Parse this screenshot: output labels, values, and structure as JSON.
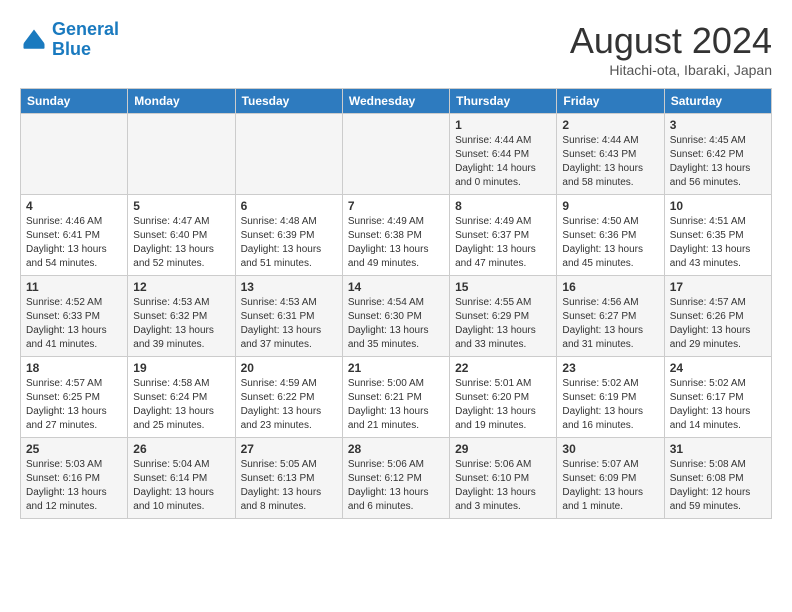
{
  "header": {
    "logo_line1": "General",
    "logo_line2": "Blue",
    "month_year": "August 2024",
    "location": "Hitachi-ota, Ibaraki, Japan"
  },
  "weekdays": [
    "Sunday",
    "Monday",
    "Tuesday",
    "Wednesday",
    "Thursday",
    "Friday",
    "Saturday"
  ],
  "weeks": [
    [
      {
        "day": "",
        "info": ""
      },
      {
        "day": "",
        "info": ""
      },
      {
        "day": "",
        "info": ""
      },
      {
        "day": "",
        "info": ""
      },
      {
        "day": "1",
        "info": "Sunrise: 4:44 AM\nSunset: 6:44 PM\nDaylight: 14 hours\nand 0 minutes."
      },
      {
        "day": "2",
        "info": "Sunrise: 4:44 AM\nSunset: 6:43 PM\nDaylight: 13 hours\nand 58 minutes."
      },
      {
        "day": "3",
        "info": "Sunrise: 4:45 AM\nSunset: 6:42 PM\nDaylight: 13 hours\nand 56 minutes."
      }
    ],
    [
      {
        "day": "4",
        "info": "Sunrise: 4:46 AM\nSunset: 6:41 PM\nDaylight: 13 hours\nand 54 minutes."
      },
      {
        "day": "5",
        "info": "Sunrise: 4:47 AM\nSunset: 6:40 PM\nDaylight: 13 hours\nand 52 minutes."
      },
      {
        "day": "6",
        "info": "Sunrise: 4:48 AM\nSunset: 6:39 PM\nDaylight: 13 hours\nand 51 minutes."
      },
      {
        "day": "7",
        "info": "Sunrise: 4:49 AM\nSunset: 6:38 PM\nDaylight: 13 hours\nand 49 minutes."
      },
      {
        "day": "8",
        "info": "Sunrise: 4:49 AM\nSunset: 6:37 PM\nDaylight: 13 hours\nand 47 minutes."
      },
      {
        "day": "9",
        "info": "Sunrise: 4:50 AM\nSunset: 6:36 PM\nDaylight: 13 hours\nand 45 minutes."
      },
      {
        "day": "10",
        "info": "Sunrise: 4:51 AM\nSunset: 6:35 PM\nDaylight: 13 hours\nand 43 minutes."
      }
    ],
    [
      {
        "day": "11",
        "info": "Sunrise: 4:52 AM\nSunset: 6:33 PM\nDaylight: 13 hours\nand 41 minutes."
      },
      {
        "day": "12",
        "info": "Sunrise: 4:53 AM\nSunset: 6:32 PM\nDaylight: 13 hours\nand 39 minutes."
      },
      {
        "day": "13",
        "info": "Sunrise: 4:53 AM\nSunset: 6:31 PM\nDaylight: 13 hours\nand 37 minutes."
      },
      {
        "day": "14",
        "info": "Sunrise: 4:54 AM\nSunset: 6:30 PM\nDaylight: 13 hours\nand 35 minutes."
      },
      {
        "day": "15",
        "info": "Sunrise: 4:55 AM\nSunset: 6:29 PM\nDaylight: 13 hours\nand 33 minutes."
      },
      {
        "day": "16",
        "info": "Sunrise: 4:56 AM\nSunset: 6:27 PM\nDaylight: 13 hours\nand 31 minutes."
      },
      {
        "day": "17",
        "info": "Sunrise: 4:57 AM\nSunset: 6:26 PM\nDaylight: 13 hours\nand 29 minutes."
      }
    ],
    [
      {
        "day": "18",
        "info": "Sunrise: 4:57 AM\nSunset: 6:25 PM\nDaylight: 13 hours\nand 27 minutes."
      },
      {
        "day": "19",
        "info": "Sunrise: 4:58 AM\nSunset: 6:24 PM\nDaylight: 13 hours\nand 25 minutes."
      },
      {
        "day": "20",
        "info": "Sunrise: 4:59 AM\nSunset: 6:22 PM\nDaylight: 13 hours\nand 23 minutes."
      },
      {
        "day": "21",
        "info": "Sunrise: 5:00 AM\nSunset: 6:21 PM\nDaylight: 13 hours\nand 21 minutes."
      },
      {
        "day": "22",
        "info": "Sunrise: 5:01 AM\nSunset: 6:20 PM\nDaylight: 13 hours\nand 19 minutes."
      },
      {
        "day": "23",
        "info": "Sunrise: 5:02 AM\nSunset: 6:19 PM\nDaylight: 13 hours\nand 16 minutes."
      },
      {
        "day": "24",
        "info": "Sunrise: 5:02 AM\nSunset: 6:17 PM\nDaylight: 13 hours\nand 14 minutes."
      }
    ],
    [
      {
        "day": "25",
        "info": "Sunrise: 5:03 AM\nSunset: 6:16 PM\nDaylight: 13 hours\nand 12 minutes."
      },
      {
        "day": "26",
        "info": "Sunrise: 5:04 AM\nSunset: 6:14 PM\nDaylight: 13 hours\nand 10 minutes."
      },
      {
        "day": "27",
        "info": "Sunrise: 5:05 AM\nSunset: 6:13 PM\nDaylight: 13 hours\nand 8 minutes."
      },
      {
        "day": "28",
        "info": "Sunrise: 5:06 AM\nSunset: 6:12 PM\nDaylight: 13 hours\nand 6 minutes."
      },
      {
        "day": "29",
        "info": "Sunrise: 5:06 AM\nSunset: 6:10 PM\nDaylight: 13 hours\nand 3 minutes."
      },
      {
        "day": "30",
        "info": "Sunrise: 5:07 AM\nSunset: 6:09 PM\nDaylight: 13 hours\nand 1 minute."
      },
      {
        "day": "31",
        "info": "Sunrise: 5:08 AM\nSunset: 6:08 PM\nDaylight: 12 hours\nand 59 minutes."
      }
    ]
  ]
}
